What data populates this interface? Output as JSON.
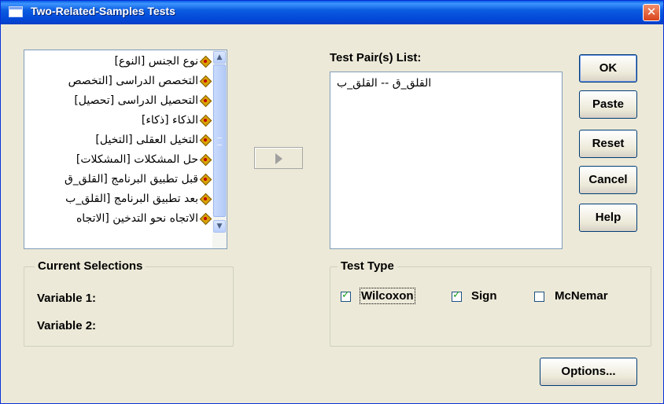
{
  "window": {
    "title": "Two-Related-Samples Tests",
    "close_glyph": "✕"
  },
  "variables": [
    "نوع الجنس [النوع]",
    "التخصص الدراسى [التخصص",
    "التحصيل الدراسى [تحصيل]",
    "الذكاء [ذكاء]",
    "التخيل العقلى [التخيل]",
    "حل المشكلات [المشكلات]",
    "قبل تطبيق البرنامج [القلق_ق",
    "بعد تطبيق البرنامج [القلق_ب",
    "الاتجاه نحو التدخين [الاتجاه"
  ],
  "test_pairs": {
    "label": "Test Pair(s) List:",
    "items": [
      "القلق_ق -- القلق_ب"
    ]
  },
  "buttons": {
    "ok": "OK",
    "paste": "Paste",
    "reset": "Reset",
    "cancel": "Cancel",
    "help": "Help",
    "options": "Options..."
  },
  "current_selections": {
    "title": "Current Selections",
    "variable1": "Variable 1:",
    "variable2": "Variable 2:"
  },
  "test_type": {
    "title": "Test Type",
    "wilcoxon": {
      "label": "Wilcoxon",
      "checked": true
    },
    "sign": {
      "label": "Sign",
      "checked": true
    },
    "mcnemar": {
      "label": "McNemar",
      "checked": false
    }
  },
  "icons": {
    "variable": "ruler-diamond-icon",
    "move": "arrow-right-icon"
  }
}
